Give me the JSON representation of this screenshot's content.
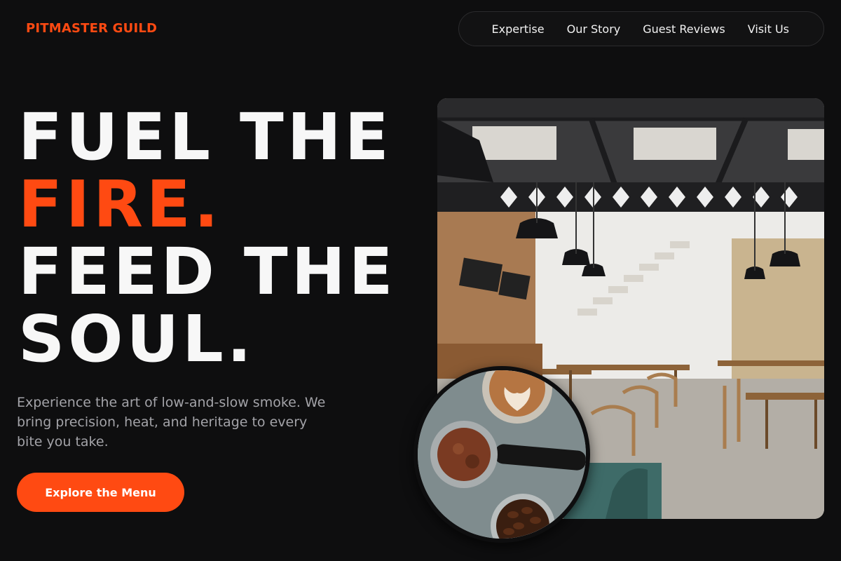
{
  "brand": {
    "name": "PITMASTER GUILD"
  },
  "nav": {
    "items": [
      "Expertise",
      "Our Story",
      "Guest Reviews",
      "Visit Us"
    ]
  },
  "hero": {
    "line1": "FUEL THE",
    "line2": "FIRE.",
    "line3": "FEED THE",
    "line4": "SOUL.",
    "subtext": "Experience the art of low-and-slow smoke. We bring precision, heat, and heritage to every bite you take.",
    "cta_label": "Explore the Menu"
  },
  "colors": {
    "accent": "#ff4a12",
    "background": "#0e0e0f",
    "headline": "#f7f7f7",
    "subtext": "#a3a3a8"
  },
  "images": {
    "main": "restaurant-interior-photo",
    "secondary": "coffee-espresso-photo"
  }
}
